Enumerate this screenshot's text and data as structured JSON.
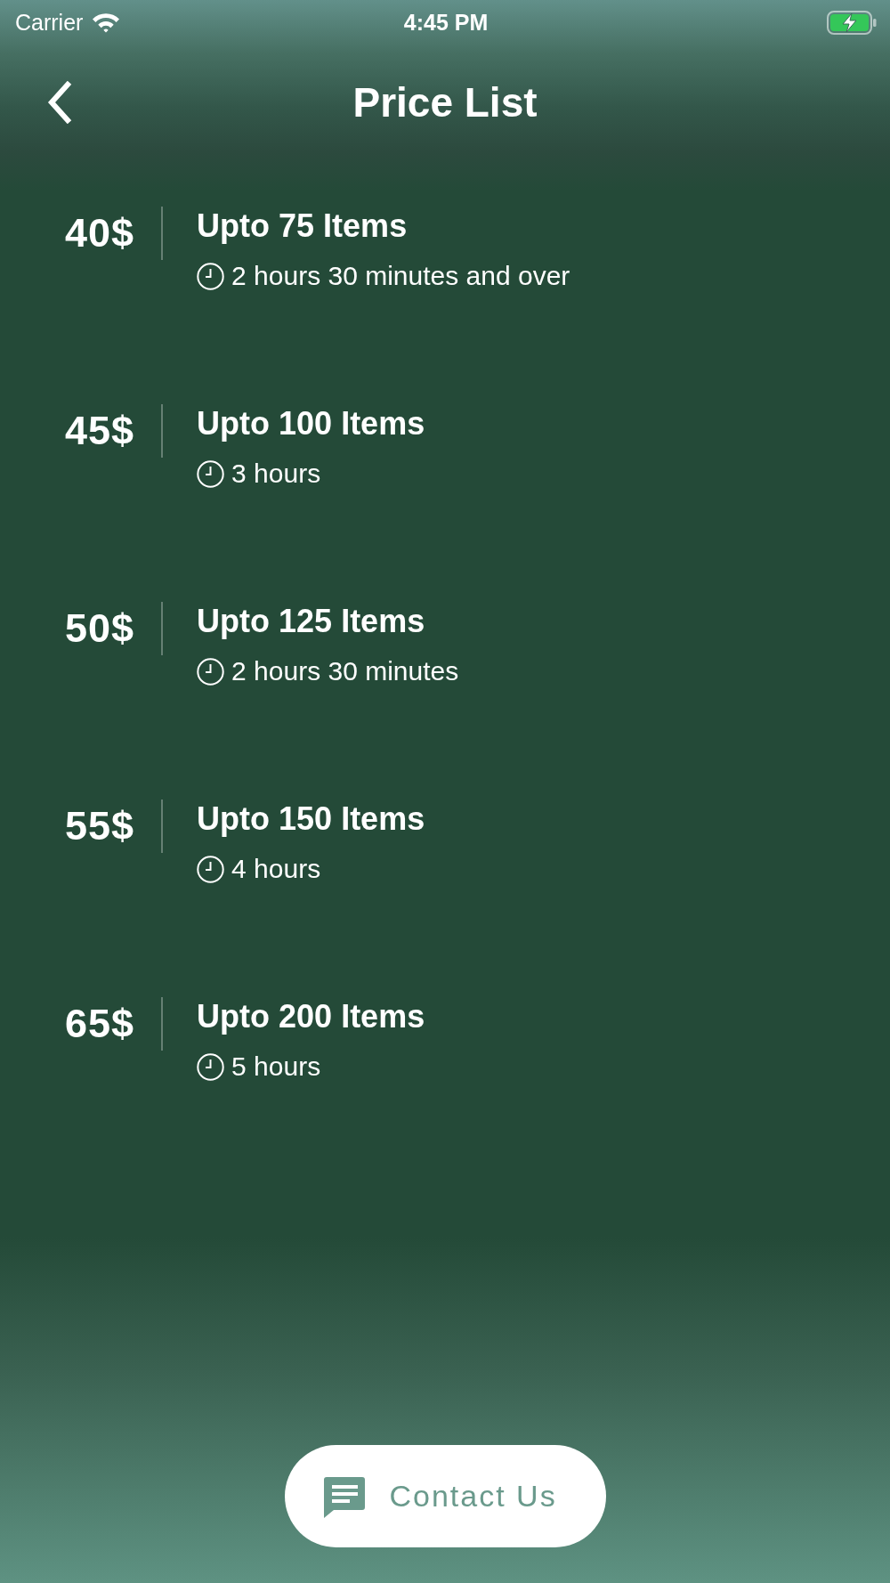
{
  "status_bar": {
    "carrier": "Carrier",
    "time": "4:45 PM",
    "charging": true
  },
  "header": {
    "title": "Price List"
  },
  "plans": [
    {
      "price": "40$",
      "title": "Upto 75 Items",
      "duration": "2 hours 30 minutes and over"
    },
    {
      "price": "45$",
      "title": "Upto 100 Items",
      "duration": "3 hours"
    },
    {
      "price": "50$",
      "title": "Upto 125 Items",
      "duration": "2 hours 30 minutes"
    },
    {
      "price": "55$",
      "title": "Upto 150 Items",
      "duration": "4 hours"
    },
    {
      "price": "65$",
      "title": "Upto 200 Items",
      "duration": "5 hours"
    }
  ],
  "contact_button": {
    "label": "Contact Us"
  }
}
